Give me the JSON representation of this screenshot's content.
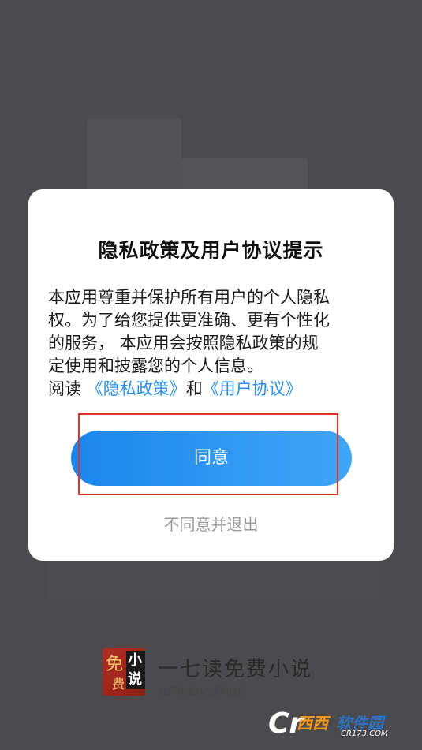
{
  "dialog": {
    "title": "隐私政策及用户协议提示",
    "lines": [
      "本应用尊重并保护所有用户的个人隐私",
      "权。为了给您提供更准确、更有个性化",
      "的服务， 本应用会按照隐私政策的规",
      "定使用和披露您的个人信息。"
    ],
    "read_prefix": "阅读",
    "privacy_link": "《隐私政策》",
    "and_text": "和",
    "terms_link": "《用户协议》",
    "agree_label": "同意",
    "disagree_label": "不同意并退出"
  },
  "brand": {
    "logo_char_1": "免",
    "logo_char_2": "费",
    "logo_char_3": "小说",
    "name": "一七读免费小说",
    "slogan": "让阅读成为心灵的旅行"
  },
  "watermark": {
    "c": "Cr",
    "xixi": "西西",
    "ruanjian": "软件园",
    "url": "CR173.COM"
  },
  "colors": {
    "accent": "#2a8fe8",
    "highlight_box": "#e0332c"
  }
}
